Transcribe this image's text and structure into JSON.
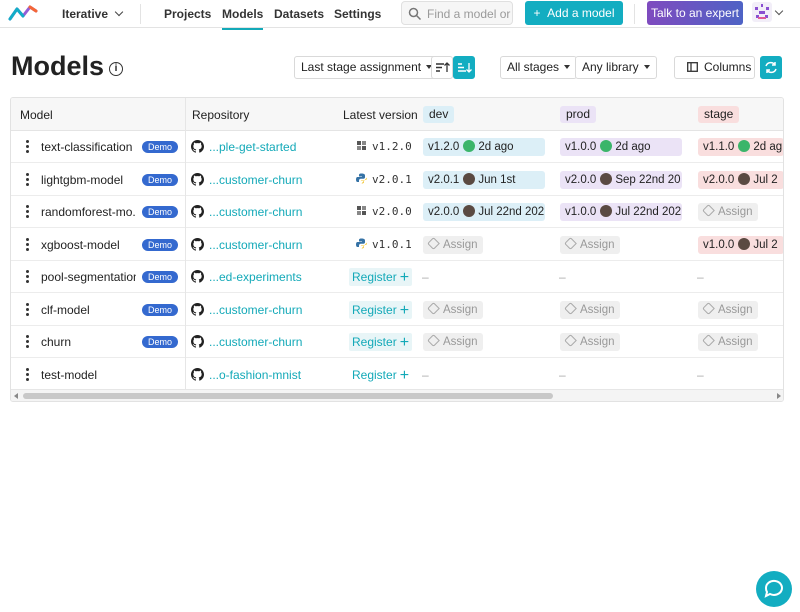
{
  "topbar": {
    "org": "Iterative",
    "nav": [
      "Projects",
      "Models",
      "Datasets",
      "Settings"
    ],
    "active_nav": "Models",
    "search_placeholder": "Find a model or re",
    "add_model": "Add a model",
    "talk_expert": "Talk to an expert"
  },
  "page": {
    "title": "Models",
    "sort_select": "Last stage assignment",
    "stages_filter": "All stages",
    "library_filter": "Any library",
    "columns_button": "Columns"
  },
  "table": {
    "headers": {
      "name": "Model",
      "repository": "Repository",
      "latest": "Latest version"
    },
    "stages": [
      "dev",
      "prod",
      "stage"
    ],
    "assign_label": "Assign",
    "register_label": "Register",
    "demo_label": "Demo",
    "dash": "–",
    "rows": [
      {
        "name": "text-classification",
        "demo": true,
        "repo": "...ple-get-started",
        "lib": "dvc",
        "version": "v1.2.0",
        "dev": {
          "v": "v1.2.0",
          "who": "green",
          "when": "2d ago"
        },
        "prod": {
          "v": "v1.0.0",
          "who": "green",
          "when": "2d ago"
        },
        "stage": {
          "v": "v1.1.0",
          "who": "green",
          "when": "2d ag"
        }
      },
      {
        "name": "lightgbm-model",
        "demo": true,
        "repo": "...customer-churn",
        "lib": "python",
        "version": "v2.0.1",
        "dev": {
          "v": "v2.0.1",
          "who": "face",
          "when": "Jun 1st"
        },
        "prod": {
          "v": "v2.0.0",
          "who": "face",
          "when": "Sep 22nd 20"
        },
        "stage": {
          "v": "v2.0.0",
          "who": "face",
          "when": "Jul 2"
        }
      },
      {
        "name": "randomforest-mo...",
        "demo": true,
        "repo": "...customer-churn",
        "lib": "dvc",
        "version": "v2.0.0",
        "dev": {
          "v": "v2.0.0",
          "who": "face",
          "when": "Jul 22nd 202"
        },
        "prod": {
          "v": "v1.0.0",
          "who": "face",
          "when": "Jul 22nd 202"
        },
        "stage": null
      },
      {
        "name": "xgboost-model",
        "demo": true,
        "repo": "...customer-churn",
        "lib": "python",
        "version": "v1.0.1",
        "dev": null,
        "prod": null,
        "stage": {
          "v": "v1.0.0",
          "who": "face",
          "when": "Jul 2"
        }
      },
      {
        "name": "pool-segmentation",
        "demo": true,
        "repo": "...ed-experiments",
        "register": true,
        "register_bg": true,
        "empty": true
      },
      {
        "name": "clf-model",
        "demo": true,
        "repo": "...customer-churn",
        "register": true,
        "register_bg": true,
        "dev": null,
        "prod": null,
        "stage": null
      },
      {
        "name": "churn",
        "demo": true,
        "repo": "...customer-churn",
        "register": true,
        "register_bg": true,
        "dev": null,
        "prod": null,
        "stage": null
      },
      {
        "name": "test-model",
        "demo": false,
        "repo": "...o-fashion-mnist",
        "register": true,
        "register_bg": false,
        "empty": true
      }
    ]
  },
  "colors": {
    "accent": "#13adc1",
    "demo_badge": "#3469cf",
    "dev": "#dceff7",
    "prod": "#ebe3f6",
    "stage": "#f9dede"
  }
}
